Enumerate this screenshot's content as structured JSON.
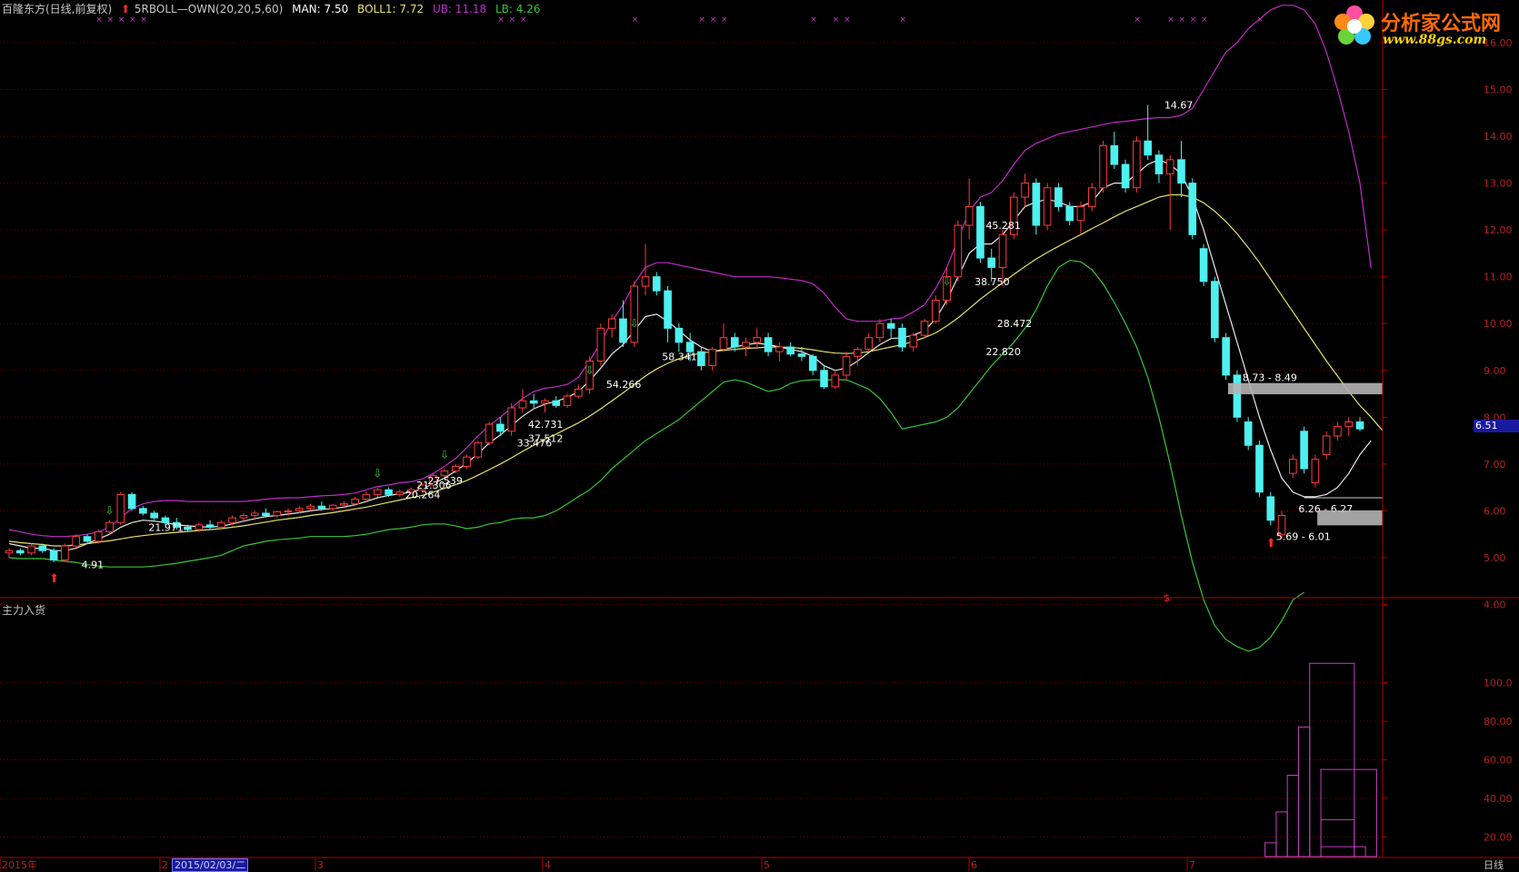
{
  "header": {
    "stock": "百隆东方(日线,前复权)",
    "indicator": "5RBOLL—OWN(20,20,5,60)",
    "man": "MAN: 7.50",
    "boll": "BOLL1: 7.72",
    "ub": "UB: 11.18",
    "lb": "LB: 4.26"
  },
  "colors": {
    "up_candle": "#ff3b3b",
    "down_candle": "#4ff0f0",
    "mid_line": "#e8e8e8",
    "boll_line": "#e6e26a",
    "ub_line": "#c02cc8",
    "lb_line": "#39c439",
    "axis_red": "#b00000",
    "grid": "#700000",
    "volume_bars": "#c040c0"
  },
  "logo": {
    "title": "分析家公式网",
    "url": "www.88gs.com"
  },
  "price_axis": {
    "labels": [
      "16.00",
      "15.00",
      "14.00",
      "13.00",
      "12.00",
      "11.00",
      "10.00",
      "9.00",
      "8.00",
      "7.00",
      "6.00",
      "5.00",
      "4.00"
    ]
  },
  "current_price": "6.51",
  "sub_panel": {
    "title": "主力入货",
    "axis_labels": [
      "100.0",
      "80.00",
      "60.00",
      "40.00",
      "20.00"
    ]
  },
  "time_axis": {
    "labels": [
      "2015年",
      "2",
      "3",
      "4",
      "5",
      "6",
      "7"
    ],
    "selected_date": "2015/02/03/二",
    "period": "日线"
  },
  "annotations": [
    {
      "text": "4.91"
    },
    {
      "text": "21.971"
    },
    {
      "text": "20.264"
    },
    {
      "text": "21.306"
    },
    {
      "text": "27.539"
    },
    {
      "text": "33.476"
    },
    {
      "text": "42.731"
    },
    {
      "text": "37.512"
    },
    {
      "text": "54.266"
    },
    {
      "text": "58.341"
    },
    {
      "text": "45.281"
    },
    {
      "text": "38.750"
    },
    {
      "text": "28.472"
    },
    {
      "text": "22.820"
    },
    {
      "text": "14.67"
    },
    {
      "text": "8.73 - 8.49"
    },
    {
      "text": "6.26 - 6.27"
    },
    {
      "text": "5.69 - 6.01"
    }
  ],
  "chart_data": {
    "type": "line",
    "ylim": [
      3.0,
      16.0
    ],
    "candles": [
      [
        5.1,
        5.2,
        5.0,
        5.15
      ],
      [
        5.15,
        5.2,
        5.05,
        5.1
      ],
      [
        5.1,
        5.3,
        5.05,
        5.25
      ],
      [
        5.25,
        5.3,
        5.1,
        5.15
      ],
      [
        5.15,
        5.2,
        4.9,
        4.95
      ],
      [
        4.95,
        5.3,
        4.91,
        5.25
      ],
      [
        5.25,
        5.5,
        5.2,
        5.45
      ],
      [
        5.45,
        5.5,
        5.3,
        5.35
      ],
      [
        5.35,
        5.6,
        5.3,
        5.55
      ],
      [
        5.55,
        5.8,
        5.5,
        5.75
      ],
      [
        5.75,
        6.4,
        5.7,
        6.35
      ],
      [
        6.35,
        6.4,
        6.0,
        6.05
      ],
      [
        6.05,
        6.1,
        5.9,
        5.95
      ],
      [
        5.95,
        6.0,
        5.8,
        5.85
      ],
      [
        5.85,
        5.9,
        5.7,
        5.75
      ],
      [
        5.75,
        5.85,
        5.6,
        5.65
      ],
      [
        5.65,
        5.7,
        5.55,
        5.6
      ],
      [
        5.6,
        5.75,
        5.55,
        5.7
      ],
      [
        5.7,
        5.8,
        5.6,
        5.65
      ],
      [
        5.65,
        5.8,
        5.6,
        5.75
      ],
      [
        5.75,
        5.9,
        5.7,
        5.85
      ],
      [
        5.85,
        5.95,
        5.75,
        5.9
      ],
      [
        5.9,
        6.0,
        5.8,
        5.95
      ],
      [
        5.95,
        6.05,
        5.85,
        5.9
      ],
      [
        5.9,
        6.0,
        5.85,
        5.98
      ],
      [
        5.98,
        6.05,
        5.9,
        6.0
      ],
      [
        6.0,
        6.1,
        5.95,
        6.05
      ],
      [
        6.05,
        6.15,
        6.0,
        6.1
      ],
      [
        6.1,
        6.2,
        6.0,
        6.05
      ],
      [
        6.05,
        6.15,
        6.0,
        6.12
      ],
      [
        6.12,
        6.2,
        6.05,
        6.15
      ],
      [
        6.15,
        6.3,
        6.1,
        6.25
      ],
      [
        6.25,
        6.4,
        6.2,
        6.35
      ],
      [
        6.35,
        6.5,
        6.3,
        6.45
      ],
      [
        6.45,
        6.5,
        6.3,
        6.35
      ],
      [
        6.35,
        6.45,
        6.3,
        6.4
      ],
      [
        6.4,
        6.5,
        6.35,
        6.45
      ],
      [
        6.45,
        6.6,
        6.4,
        6.55
      ],
      [
        6.55,
        6.8,
        6.5,
        6.75
      ],
      [
        6.75,
        6.9,
        6.7,
        6.85
      ],
      [
        6.85,
        7.0,
        6.8,
        6.95
      ],
      [
        6.95,
        7.2,
        6.9,
        7.15
      ],
      [
        7.15,
        7.5,
        7.1,
        7.45
      ],
      [
        7.45,
        7.9,
        7.4,
        7.85
      ],
      [
        7.85,
        8.0,
        7.6,
        7.7
      ],
      [
        7.7,
        8.3,
        7.6,
        8.2
      ],
      [
        8.2,
        8.6,
        8.1,
        8.35
      ],
      [
        8.35,
        8.5,
        8.2,
        8.3
      ],
      [
        8.3,
        8.4,
        8.1,
        8.35
      ],
      [
        8.35,
        8.45,
        8.2,
        8.25
      ],
      [
        8.25,
        8.5,
        8.2,
        8.45
      ],
      [
        8.45,
        8.7,
        8.4,
        8.6
      ],
      [
        8.6,
        9.3,
        8.5,
        9.2
      ],
      [
        9.2,
        10.0,
        9.1,
        9.9
      ],
      [
        9.9,
        10.2,
        9.7,
        10.1
      ],
      [
        10.1,
        10.5,
        9.5,
        9.6
      ],
      [
        9.6,
        10.9,
        9.5,
        10.8
      ],
      [
        10.8,
        11.7,
        10.6,
        11.0
      ],
      [
        11.0,
        11.1,
        10.6,
        10.7
      ],
      [
        10.7,
        10.8,
        9.6,
        9.9
      ],
      [
        9.9,
        10.0,
        9.4,
        9.6
      ],
      [
        9.6,
        9.8,
        9.2,
        9.4
      ],
      [
        9.4,
        9.5,
        9.0,
        9.1
      ],
      [
        9.1,
        9.5,
        9.0,
        9.45
      ],
      [
        9.45,
        10.0,
        9.4,
        9.7
      ],
      [
        9.7,
        9.8,
        9.4,
        9.5
      ],
      [
        9.5,
        9.7,
        9.3,
        9.6
      ],
      [
        9.6,
        9.9,
        9.5,
        9.7
      ],
      [
        9.7,
        9.8,
        9.3,
        9.4
      ],
      [
        9.4,
        9.6,
        9.2,
        9.5
      ],
      [
        9.5,
        9.6,
        9.3,
        9.35
      ],
      [
        9.35,
        9.5,
        9.2,
        9.3
      ],
      [
        9.3,
        9.35,
        8.9,
        9.0
      ],
      [
        9.0,
        9.1,
        8.6,
        8.65
      ],
      [
        8.65,
        9.0,
        8.6,
        8.9
      ],
      [
        8.9,
        9.4,
        8.8,
        9.3
      ],
      [
        9.3,
        9.5,
        9.1,
        9.45
      ],
      [
        9.45,
        9.8,
        9.4,
        9.7
      ],
      [
        9.7,
        10.1,
        9.6,
        10.0
      ],
      [
        10.0,
        10.1,
        9.7,
        9.9
      ],
      [
        9.9,
        10.0,
        9.4,
        9.5
      ],
      [
        9.5,
        9.8,
        9.4,
        9.75
      ],
      [
        9.75,
        10.1,
        9.7,
        10.05
      ],
      [
        10.05,
        10.6,
        10.0,
        10.5
      ],
      [
        10.5,
        11.2,
        10.4,
        11.0
      ],
      [
        11.0,
        12.2,
        10.9,
        12.1
      ],
      [
        12.1,
        13.1,
        11.8,
        12.5
      ],
      [
        12.5,
        12.6,
        11.3,
        11.4
      ],
      [
        11.4,
        11.6,
        10.9,
        11.2
      ],
      [
        11.2,
        12.0,
        10.8,
        11.9
      ],
      [
        11.9,
        12.8,
        11.8,
        12.7
      ],
      [
        12.7,
        13.2,
        12.5,
        13.0
      ],
      [
        13.0,
        13.1,
        11.9,
        12.1
      ],
      [
        12.1,
        13.0,
        12.0,
        12.9
      ],
      [
        12.9,
        13.0,
        12.4,
        12.5
      ],
      [
        12.5,
        12.6,
        12.1,
        12.2
      ],
      [
        12.2,
        12.6,
        11.9,
        12.5
      ],
      [
        12.5,
        13.0,
        12.4,
        12.9
      ],
      [
        12.9,
        13.9,
        12.8,
        13.8
      ],
      [
        13.8,
        14.1,
        13.3,
        13.4
      ],
      [
        13.4,
        13.5,
        12.8,
        12.9
      ],
      [
        12.9,
        14.0,
        12.8,
        13.9
      ],
      [
        13.9,
        14.67,
        13.5,
        13.6
      ],
      [
        13.6,
        13.7,
        13.0,
        13.2
      ],
      [
        13.2,
        13.6,
        12.0,
        13.5
      ],
      [
        13.5,
        13.9,
        12.7,
        13.0
      ],
      [
        13.0,
        13.1,
        11.8,
        11.9
      ],
      [
        11.6,
        11.7,
        10.8,
        10.9
      ],
      [
        10.9,
        11.0,
        9.6,
        9.7
      ],
      [
        9.7,
        9.8,
        8.8,
        8.9
      ],
      [
        8.9,
        9.0,
        7.9,
        8.0
      ],
      [
        7.9,
        8.0,
        7.3,
        7.4
      ],
      [
        7.4,
        7.5,
        6.3,
        6.4
      ],
      [
        6.3,
        6.4,
        5.69,
        5.8
      ],
      [
        5.5,
        6.0,
        5.4,
        5.9
      ],
      [
        6.8,
        7.2,
        6.7,
        7.1
      ],
      [
        7.7,
        7.8,
        6.8,
        6.9
      ],
      [
        6.6,
        7.2,
        6.5,
        7.1
      ],
      [
        7.2,
        7.7,
        7.1,
        7.6
      ],
      [
        7.6,
        7.9,
        7.5,
        7.8
      ],
      [
        7.8,
        8.0,
        7.6,
        7.9
      ],
      [
        7.9,
        8.0,
        7.7,
        7.75
      ]
    ],
    "lines": [
      {
        "role": "mid",
        "values": [
          5.3,
          5.25,
          5.2,
          5.2,
          5.15,
          5.15,
          5.2,
          5.3,
          5.4,
          5.5,
          5.65,
          5.75,
          5.8,
          5.78,
          5.75,
          5.7,
          5.68,
          5.66,
          5.65,
          5.67,
          5.72,
          5.78,
          5.83,
          5.88,
          5.9,
          5.93,
          5.96,
          6.0,
          6.03,
          6.05,
          6.08,
          6.13,
          6.2,
          6.28,
          6.33,
          6.36,
          6.4,
          6.47,
          6.58,
          6.7,
          6.85,
          7.02,
          7.22,
          7.45,
          7.62,
          7.82,
          8.02,
          8.18,
          8.28,
          8.34,
          8.42,
          8.55,
          8.78,
          9.05,
          9.35,
          9.55,
          9.85,
          10.15,
          10.2,
          10.05,
          9.85,
          9.65,
          9.5,
          9.4,
          9.45,
          9.5,
          9.55,
          9.58,
          9.55,
          9.5,
          9.45,
          9.4,
          9.3,
          9.1,
          9.0,
          9.05,
          9.2,
          9.38,
          9.55,
          9.68,
          9.7,
          9.75,
          9.85,
          10.1,
          10.5,
          11.0,
          11.5,
          11.7,
          11.7,
          11.9,
          12.2,
          12.5,
          12.6,
          12.65,
          12.6,
          12.5,
          12.5,
          12.6,
          12.9,
          13.0,
          13.0,
          13.2,
          13.4,
          13.5,
          13.4,
          13.2,
          12.7,
          12.0,
          11.2,
          10.4,
          9.6,
          8.8,
          8.0,
          7.3,
          6.7,
          6.4,
          6.3,
          6.3,
          6.35,
          6.5,
          6.8,
          7.2,
          7.5
        ]
      },
      {
        "role": "boll",
        "values": [
          5.35,
          5.32,
          5.3,
          5.28,
          5.25,
          5.25,
          5.27,
          5.3,
          5.33,
          5.36,
          5.4,
          5.44,
          5.47,
          5.5,
          5.52,
          5.54,
          5.56,
          5.58,
          5.6,
          5.62,
          5.65,
          5.68,
          5.72,
          5.76,
          5.8,
          5.83,
          5.86,
          5.9,
          5.93,
          5.96,
          6.0,
          6.04,
          6.08,
          6.13,
          6.18,
          6.23,
          6.28,
          6.33,
          6.4,
          6.48,
          6.56,
          6.65,
          6.76,
          6.88,
          7.0,
          7.13,
          7.27,
          7.4,
          7.53,
          7.64,
          7.76,
          7.88,
          8.02,
          8.18,
          8.35,
          8.52,
          8.7,
          8.88,
          9.03,
          9.15,
          9.25,
          9.32,
          9.37,
          9.4,
          9.43,
          9.45,
          9.47,
          9.48,
          9.5,
          9.5,
          9.49,
          9.47,
          9.44,
          9.4,
          9.37,
          9.36,
          9.37,
          9.4,
          9.45,
          9.5,
          9.55,
          9.62,
          9.7,
          9.8,
          9.95,
          10.12,
          10.32,
          10.52,
          10.7,
          10.87,
          11.05,
          11.22,
          11.38,
          11.52,
          11.65,
          11.78,
          11.9,
          12.03,
          12.15,
          12.28,
          12.4,
          12.5,
          12.6,
          12.7,
          12.75,
          12.75,
          12.7,
          12.58,
          12.4,
          12.18,
          11.92,
          11.62,
          11.3,
          10.95,
          10.6,
          10.25,
          9.9,
          9.55,
          9.2,
          8.88,
          8.55,
          8.25,
          8.0,
          7.72
        ]
      },
      {
        "role": "ub",
        "values": [
          5.6,
          5.55,
          5.5,
          5.47,
          5.45,
          5.45,
          5.47,
          5.5,
          5.55,
          5.65,
          5.85,
          6.05,
          6.15,
          6.2,
          6.22,
          6.22,
          6.2,
          6.2,
          6.2,
          6.2,
          6.2,
          6.2,
          6.22,
          6.25,
          6.27,
          6.28,
          6.28,
          6.3,
          6.32,
          6.33,
          6.35,
          6.38,
          6.45,
          6.52,
          6.55,
          6.6,
          6.62,
          6.68,
          6.8,
          6.95,
          7.12,
          7.35,
          7.6,
          7.82,
          8.0,
          8.2,
          8.4,
          8.55,
          8.62,
          8.65,
          8.7,
          8.85,
          9.2,
          9.6,
          10.05,
          10.4,
          10.85,
          11.2,
          11.3,
          11.3,
          11.25,
          11.2,
          11.15,
          11.1,
          11.05,
          11.0,
          11.0,
          11.0,
          11.0,
          10.98,
          10.95,
          10.92,
          10.85,
          10.65,
          10.35,
          10.1,
          10.05,
          10.05,
          10.05,
          10.1,
          10.12,
          10.25,
          10.4,
          10.75,
          11.2,
          11.8,
          12.4,
          12.7,
          12.8,
          13.05,
          13.4,
          13.7,
          13.85,
          13.95,
          14.05,
          14.1,
          14.15,
          14.2,
          14.25,
          14.3,
          14.32,
          14.35,
          14.38,
          14.4,
          14.4,
          14.45,
          14.6,
          15.0,
          15.4,
          15.8,
          16.0,
          16.3,
          16.5,
          16.7,
          16.8,
          16.8,
          16.7,
          16.4,
          15.8,
          15.0,
          14.1,
          13.0,
          11.18
        ]
      },
      {
        "role": "lb",
        "values": [
          5.0,
          4.98,
          4.98,
          4.98,
          4.95,
          4.92,
          4.9,
          4.85,
          4.82,
          4.8,
          4.8,
          4.8,
          4.8,
          4.82,
          4.85,
          4.88,
          4.92,
          4.96,
          5.0,
          5.05,
          5.15,
          5.25,
          5.3,
          5.35,
          5.38,
          5.4,
          5.42,
          5.45,
          5.45,
          5.45,
          5.45,
          5.47,
          5.5,
          5.55,
          5.6,
          5.62,
          5.65,
          5.7,
          5.72,
          5.72,
          5.68,
          5.62,
          5.65,
          5.72,
          5.75,
          5.82,
          5.85,
          5.85,
          5.9,
          6.0,
          6.15,
          6.3,
          6.45,
          6.65,
          6.9,
          7.1,
          7.3,
          7.5,
          7.65,
          7.8,
          7.95,
          8.15,
          8.35,
          8.55,
          8.75,
          8.8,
          8.75,
          8.65,
          8.55,
          8.6,
          8.72,
          8.78,
          8.8,
          8.8,
          8.8,
          8.8,
          8.7,
          8.6,
          8.4,
          8.1,
          7.75,
          7.8,
          7.85,
          7.9,
          8.0,
          8.2,
          8.5,
          8.8,
          9.1,
          9.35,
          9.6,
          9.9,
          10.3,
          10.8,
          11.2,
          11.35,
          11.32,
          11.15,
          10.85,
          10.45,
          10.0,
          9.5,
          8.85,
          8.0,
          7.0,
          5.9,
          4.9,
          4.1,
          3.55,
          3.25,
          3.1,
          3.0,
          3.08,
          3.3,
          3.65,
          4.1,
          4.26
        ]
      }
    ],
    "volume_steps": [
      {
        "from": 117,
        "to": 121,
        "value": 110
      },
      {
        "from": 116,
        "to": 117,
        "value": 77
      },
      {
        "from": 115,
        "to": 116,
        "value": 52
      },
      {
        "from": 114,
        "to": 115,
        "value": 33
      },
      {
        "from": 113,
        "to": 114,
        "value": 17
      },
      {
        "from": 118,
        "to": 123,
        "value": 55
      },
      {
        "from": 118,
        "to": 121,
        "value": 29
      },
      {
        "from": 118,
        "to": 122,
        "value": 15
      },
      {
        "from": 119,
        "to": 124,
        "value": 9
      },
      {
        "from": 120,
        "to": 125,
        "value": 4
      },
      {
        "from": 121,
        "to": 125,
        "value": 2
      },
      {
        "from": 1,
        "to": 4,
        "value": 8
      },
      {
        "from": 1,
        "to": 5,
        "value": 5
      },
      {
        "from": 2,
        "to": 6,
        "value": 2
      }
    ],
    "xlabel": "",
    "ylabel": ""
  }
}
